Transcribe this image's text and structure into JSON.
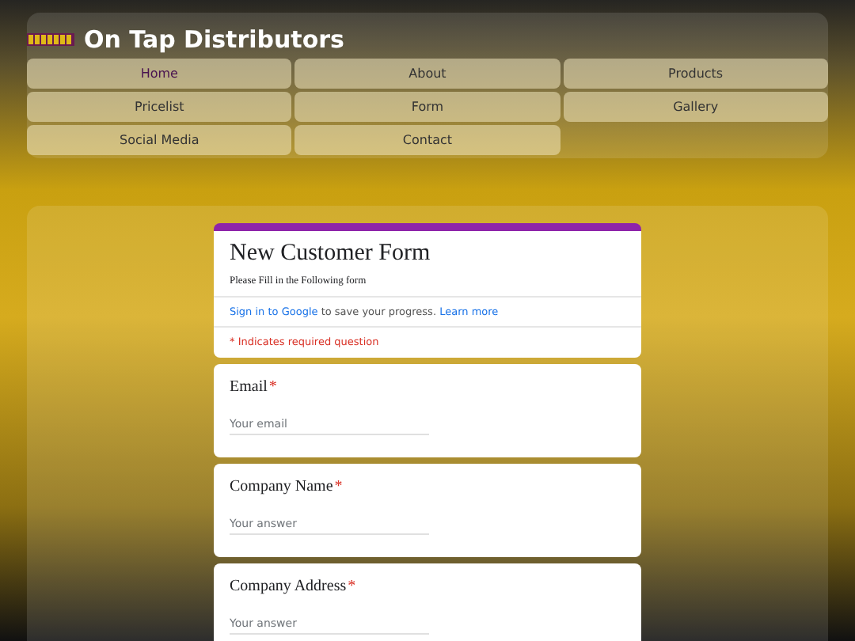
{
  "site": {
    "title": "On Tap Distributors"
  },
  "nav": [
    {
      "label": "Home",
      "selected": true
    },
    {
      "label": "About",
      "selected": false
    },
    {
      "label": "Products",
      "selected": false
    },
    {
      "label": "Pricelist",
      "selected": false
    },
    {
      "label": "Form",
      "selected": false
    },
    {
      "label": "Gallery",
      "selected": false
    },
    {
      "label": "Social Media",
      "selected": false
    },
    {
      "label": "Contact",
      "selected": false
    }
  ],
  "form": {
    "title": "New Customer Form",
    "description": "Please Fill in the Following form",
    "sign_in_link": "Sign in to Google",
    "sign_in_text": "to save your progress.",
    "learn_more": "Learn more",
    "required_note": "* Indicates required question",
    "questions": [
      {
        "label": "Email",
        "required_mark": "*",
        "placeholder": "Your email"
      },
      {
        "label": "Company Name",
        "required_mark": "*",
        "placeholder": "Your answer"
      },
      {
        "label": "Company Address",
        "required_mark": "*",
        "placeholder": "Your answer"
      }
    ]
  }
}
